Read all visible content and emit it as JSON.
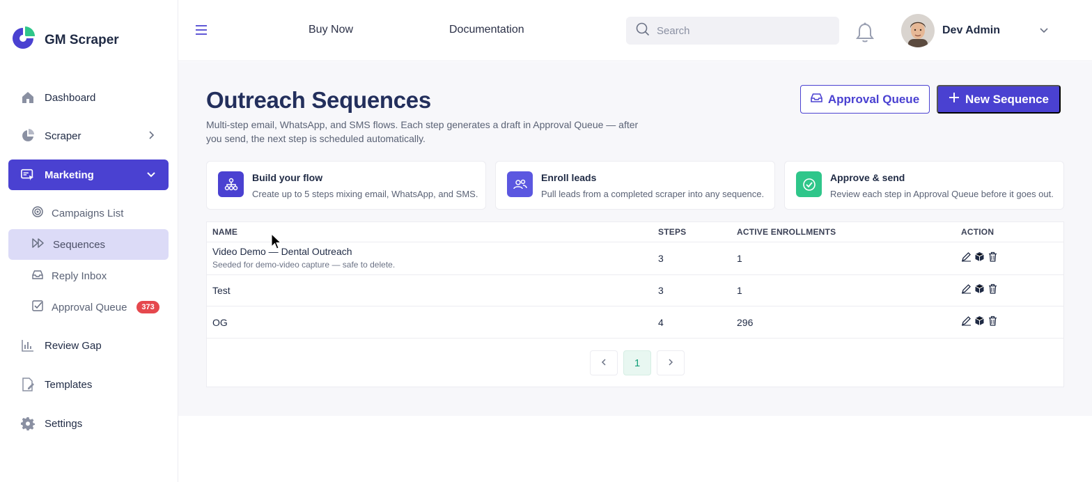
{
  "app": {
    "name": "GM Scraper"
  },
  "sidebar": {
    "items": [
      {
        "label": "Dashboard",
        "icon": "home-icon"
      },
      {
        "label": "Scraper",
        "icon": "pie-chart-icon"
      },
      {
        "label": "Marketing",
        "icon": "marketing-icon",
        "expanded": true
      },
      {
        "label": "Review Gap",
        "icon": "bar-chart-icon"
      },
      {
        "label": "Templates",
        "icon": "template-icon"
      },
      {
        "label": "Settings",
        "icon": "gear-icon"
      }
    ],
    "marketing_sub": [
      {
        "label": "Campaigns List",
        "icon": "target-icon"
      },
      {
        "label": "Sequences",
        "icon": "fast-forward-icon",
        "current": true
      },
      {
        "label": "Reply Inbox",
        "icon": "inbox-icon"
      },
      {
        "label": "Approval Queue",
        "icon": "check-square-icon",
        "badge": "373"
      }
    ]
  },
  "header": {
    "links": [
      "Buy Now",
      "Documentation"
    ],
    "search_placeholder": "Search",
    "user_name": "Dev Admin"
  },
  "page": {
    "title": "Outreach Sequences",
    "description": "Multi-step email, WhatsApp, and SMS flows. Each step generates a draft in Approval Queue — after you send, the next step is scheduled automatically.",
    "approval_queue_button": "Approval Queue",
    "new_sequence_button": "New Sequence"
  },
  "cards": [
    {
      "title": "Build your flow",
      "text": "Create up to 5 steps mixing email, WhatsApp, and SMS.",
      "color": "#4a41d1",
      "icon": "flow-icon"
    },
    {
      "title": "Enroll leads",
      "text": "Pull leads from a completed scraper into any sequence.",
      "color": "#5b57e0",
      "icon": "users-icon"
    },
    {
      "title": "Approve & send",
      "text": "Review each step in Approval Queue before it goes out.",
      "color": "#2fc68a",
      "icon": "check-circle-icon"
    }
  ],
  "table": {
    "headers": [
      "NAME",
      "STEPS",
      "ACTIVE ENROLLMENTS",
      "ACTION"
    ],
    "rows": [
      {
        "name": "Video Demo — Dental Outreach",
        "sub": "Seeded for demo-video capture — safe to delete.",
        "steps": "3",
        "enrollments": "1"
      },
      {
        "name": "Test",
        "sub": "",
        "steps": "3",
        "enrollments": "1"
      },
      {
        "name": "OG",
        "sub": "",
        "steps": "4",
        "enrollments": "296"
      }
    ]
  },
  "pagination": {
    "current": "1"
  },
  "colors": {
    "accent": "#4a41d1",
    "badge": "#e5484d",
    "success": "#2fc68a"
  }
}
